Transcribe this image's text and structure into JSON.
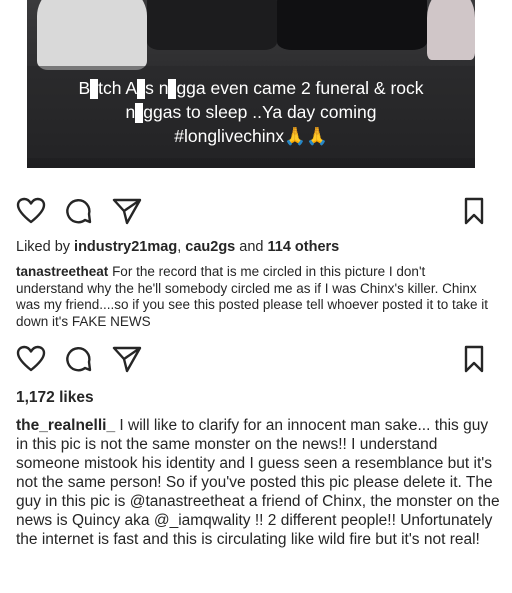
{
  "post1": {
    "caption_line1_parts": [
      "B",
      "tch A",
      "s n",
      "gga even came 2 funeral & rock"
    ],
    "caption_line2_parts": [
      "n",
      "ggas to sleep ..Ya day coming"
    ],
    "caption_line3": "#longlivechinx🙏🙏",
    "liked_prefix": "Liked by",
    "liked_user1": "industry21mag",
    "liked_sep": ",",
    "liked_user2": "cau2gs",
    "liked_and": "and",
    "liked_count": "114 others",
    "comment_user": "tanastreetheat",
    "comment_text": "For the record that is me circled in this picture I don't understand why the he'll somebody circled me as if I was Chinx's killer. Chinx was my friend....so if you see this posted please tell whoever posted it to take it down it's FAKE NEWS"
  },
  "post2": {
    "likes": "1,172 likes",
    "comment_user": "the_realnelli_",
    "comment_text": "I will like to clarify for an innocent man sake... this guy in this pic is not the same monster on the news!! I understand someone mistook his identity and I guess seen a resemblance but it's not the same person! So if you've posted this pic please delete it. The guy in this pic is @tanastreetheat a friend of Chinx, the monster on the news is Quincy aka @_iamqwality !! 2 different people!! Unfortunately the internet is fast and this is circulating like wild fire but it's not real!"
  },
  "icons": [
    "heart-icon",
    "comment-icon",
    "share-icon",
    "bookmark-icon"
  ]
}
